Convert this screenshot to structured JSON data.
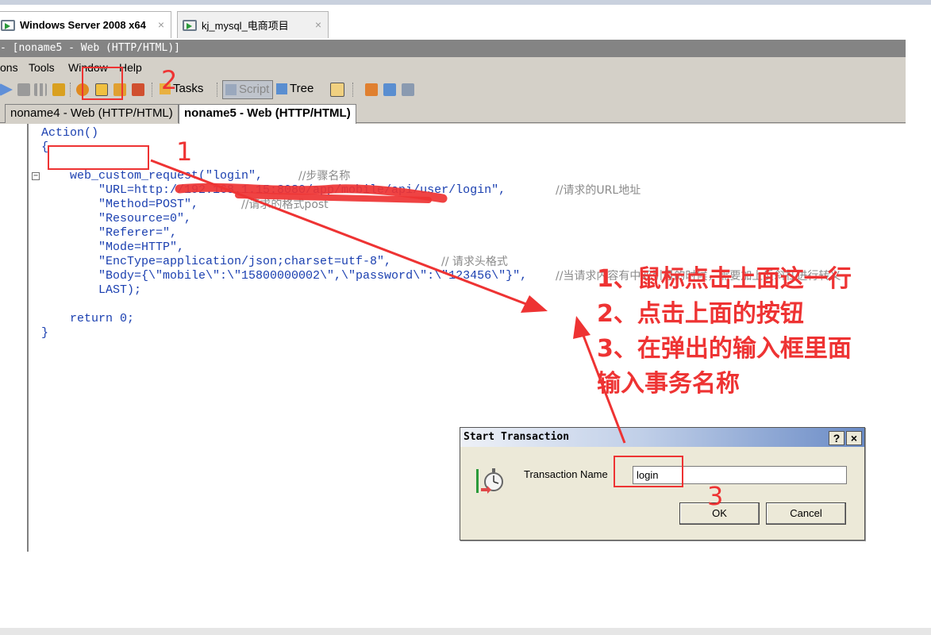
{
  "vm_tabs": [
    {
      "label": "Windows Server 2008 x64",
      "close": "×"
    },
    {
      "label": "kj_mysql_电商项目",
      "close": "×"
    }
  ],
  "app": {
    "title": "- [noname5 - Web (HTTP/HTML)]",
    "menu": [
      "ons",
      "Tools",
      "Window",
      "Help"
    ],
    "toolbar": {
      "tasks": "Tasks",
      "script": "Script",
      "tree": "Tree"
    },
    "doc_tabs": [
      "noname4 - Web (HTTP/HTML)",
      "noname5 - Web (HTTP/HTML)"
    ],
    "fold_glyph": "−"
  },
  "code": {
    "l1": "Action()",
    "l2": "{",
    "l3": "web_custom_request(\"login\",",
    "l3c": "//步骤名称",
    "l4": "\"URL=http://192.168.1.15:8080/app/mobile/api/user/login\",",
    "l4c": "//请求的URL地址",
    "l5": "\"Method=POST\",",
    "l5c": "//请求的格式post",
    "l6": "\"Resource=0\",",
    "l7": "\"Referer=\",",
    "l8": "\"Mode=HTTP\",",
    "l9": "\"EncType=application/json;charset=utf-8\",",
    "l9c": "// 请求头格式",
    "l10": "\"Body={\\\"mobile\\\":\\\"15800000002\\\",\\\"password\\\":\\\"123456\\\"}\",",
    "l10c": "//当请求内容有中双引号的时候，需要加上反斜杠进行转义",
    "l11": "LAST);",
    "l12": "return 0;",
    "l13": "}"
  },
  "dialog": {
    "title": "Start Transaction",
    "help": "?",
    "close": "×",
    "label": "Transaction Name",
    "value": "login",
    "ok": "OK",
    "cancel": "Cancel"
  },
  "annotations": {
    "n1": "1",
    "n2": "2",
    "n3": "3",
    "steps": [
      "1、鼠标点击上面这一行",
      "2、点击上面的按钮",
      "3、在弹出的输入框里面",
      "输入事务名称"
    ],
    "color": "#ee3333"
  }
}
